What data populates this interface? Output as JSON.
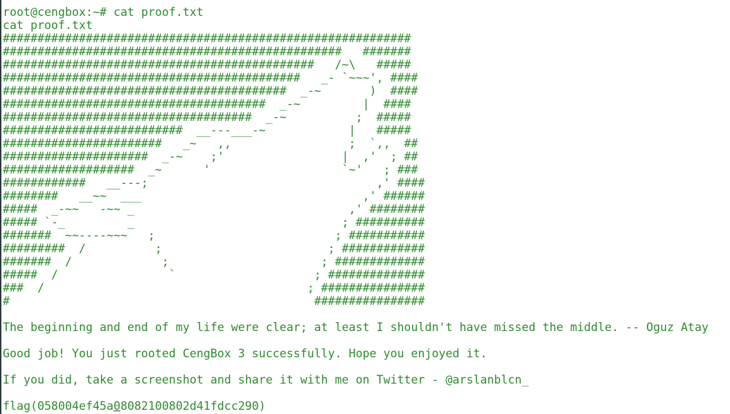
{
  "terminal": {
    "prompt": "root@cengbox:~# ",
    "command": "cat proof.txt",
    "echo": "cat proof.txt",
    "art": [
      "###########################################################",
      "#################################################   #######",
      "#############################################   /~\\   #####",
      "###########################################   _- `~~~', ####",
      "#########################################  _-~       )  ####",
      "######################################  _-~         |  ####",
      "####################################  _-~          ;  #####",
      "##########################  __---___-~            |   #####",
      "#######################   _~   ,,                 ;  `,,  ##",
      "#####################  _-~    ;'                 |  ,'  ; ##",
      "###################  _~      '                   `~'   ; ###",
      "############   __---;                                 ,' ####",
      "########   __~~  ___                                ,' ######",
      "#####  _-~~   -~~ _                               ,' ########",
      "##### `-_         _                              ; ##########",
      "#######  ~~----~~~   ;                          ; ###########",
      "#########  /          ;                        ; ############",
      "#######  /             ;                      ; #############",
      "#####  /                `                    ; ##############",
      "###  /                                      ; ###############",
      "#                                            ################"
    ],
    "quote": "The beginning and end of my life were clear; at least I shouldn't have missed the middle. -- Oguz Atay",
    "congrats": "Good job! You just rooted CengBox 3 successfully. Hope you enjoyed it.",
    "share": "If you did, take a screenshot and share it with me on Twitter - @arslanblcn_",
    "flag_prefix": "flag(058004ef45a",
    "flag_cursor_char": "0",
    "flag_suffix": "8082100802d41fdcc290)",
    "colors": {
      "text": "#2e8b2e",
      "background": "#ffffff",
      "cursor": "#333333"
    }
  }
}
